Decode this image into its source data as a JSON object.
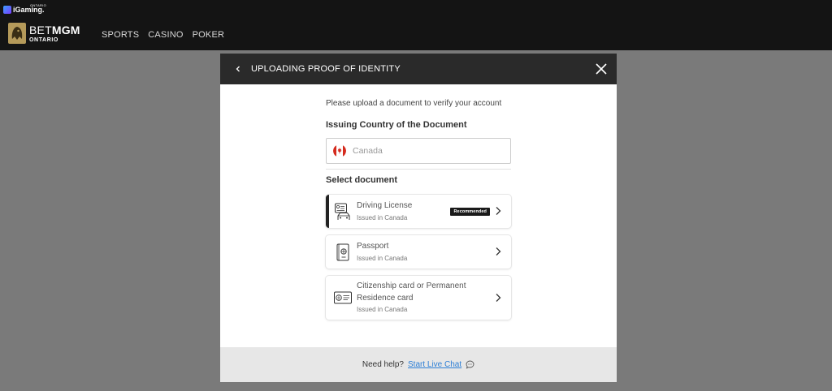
{
  "header": {
    "igaming_logo": "iGaming.",
    "igaming_region": "ONTARIO",
    "brand_light": "BET",
    "brand_bold": "MGM",
    "brand_region": "ONTARIO",
    "nav": [
      "SPORTS",
      "CASINO",
      "POKER"
    ]
  },
  "modal": {
    "title": "UPLOADING PROOF OF IDENTITY",
    "intro": "Please upload a document to verify your account",
    "country_label": "Issuing Country of the Document",
    "country_value": "Canada",
    "select_label": "Select document",
    "documents": [
      {
        "title": "Driving License",
        "subtitle": "Issued in Canada",
        "badge": "Recommended",
        "icon": "driving-license-icon"
      },
      {
        "title": "Passport",
        "subtitle": "Issued in Canada",
        "icon": "passport-icon"
      },
      {
        "title": "Citizenship card or Permanent Residence card",
        "subtitle": "Issued in Canada",
        "icon": "id-card-icon"
      }
    ],
    "help_text": "Need help?",
    "chat_link": "Start Live Chat"
  },
  "colors": {
    "overlay": "#7a7a7a",
    "header_bg": "#141414",
    "modal_header_bg": "#2a2a2a",
    "link": "#2d7fd6",
    "flag_red": "#d52b1e",
    "brand_gold": "#b59a5a"
  }
}
